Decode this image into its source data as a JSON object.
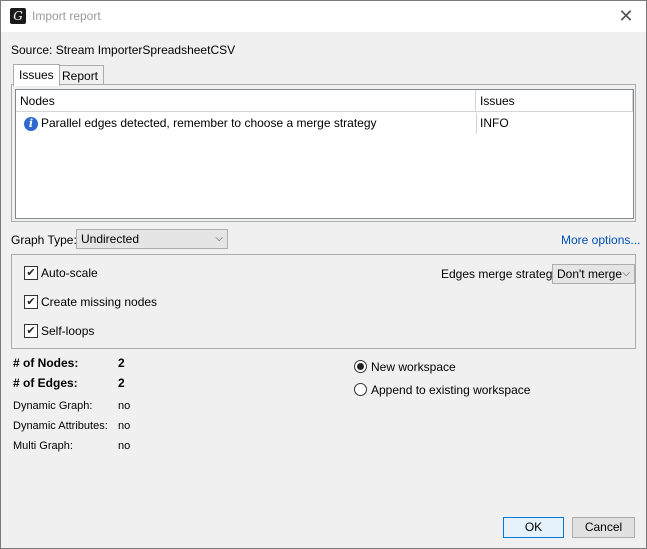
{
  "window": {
    "title": "Import report",
    "app_icon": "gephi-logo"
  },
  "source": {
    "label": "Source:",
    "value": "Stream ImporterSpreadsheetCSV"
  },
  "tabs": [
    {
      "label": "Issues",
      "active": true
    },
    {
      "label": "Report",
      "active": false
    }
  ],
  "issues_table": {
    "columns": [
      "Nodes",
      "Issues"
    ],
    "rows": [
      {
        "icon": "info-icon",
        "message": "Parallel edges detected, remember to choose a merge strategy",
        "level": "INFO"
      }
    ]
  },
  "graph_type": {
    "label": "Graph Type:",
    "value": "Undirected"
  },
  "more_options": "More options...",
  "options": {
    "auto_scale": {
      "label": "Auto-scale",
      "checked": true
    },
    "create_missing_nodes": {
      "label": "Create missing nodes",
      "checked": true
    },
    "self_loops": {
      "label": "Self-loops",
      "checked": true
    },
    "edges_merge": {
      "label": "Edges merge strategy:",
      "value": "Don't merge"
    }
  },
  "stats": {
    "nodes": {
      "label": "# of Nodes:",
      "value": "2"
    },
    "edges": {
      "label": "# of Edges:",
      "value": "2"
    },
    "dynamic_graph": {
      "label": "Dynamic Graph:",
      "value": "no"
    },
    "dynamic_attributes": {
      "label": "Dynamic Attributes:",
      "value": "no"
    },
    "multi_graph": {
      "label": "Multi Graph:",
      "value": "no"
    }
  },
  "workspace": {
    "new": {
      "label": "New workspace",
      "selected": true
    },
    "append": {
      "label": "Append to existing workspace",
      "selected": false
    }
  },
  "buttons": {
    "ok": "OK",
    "cancel": "Cancel"
  },
  "colors": {
    "link": "#0050b4",
    "accent": "#0078d7",
    "info": "#2f6ad0"
  }
}
